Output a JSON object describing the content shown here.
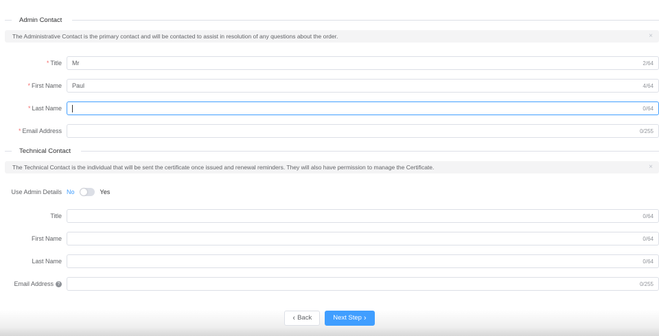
{
  "colors": {
    "accent": "#409eff",
    "required": "#f56c6c",
    "alert_bg": "#f4f4f5",
    "border": "#dcdfe6",
    "text": "#606266",
    "counter": "#909399"
  },
  "admin_section": {
    "title": "Admin Contact",
    "alert": "The Administrative Contact is the primary contact and will be contacted to assist in resolution of any questions about the order.",
    "close_label": "×",
    "fields": [
      {
        "label": "Title",
        "required": true,
        "value": "Mr",
        "counter": "2/64",
        "focused": false,
        "help": false
      },
      {
        "label": "First Name",
        "required": true,
        "value": "Paul",
        "counter": "4/64",
        "focused": false,
        "help": false
      },
      {
        "label": "Last Name",
        "required": true,
        "value": "",
        "counter": "0/64",
        "focused": true,
        "help": false
      },
      {
        "label": "Email Address",
        "required": true,
        "value": "",
        "counter": "0/255",
        "focused": false,
        "help": false
      }
    ]
  },
  "technical_section": {
    "title": "Technical Contact",
    "alert": "The Technical Contact is the individual that will be sent the certificate once issued and renewal reminders. They will also have permission to manage the Certificate.",
    "close_label": "×",
    "toggle": {
      "label": "Use Admin Details",
      "off_label": "No",
      "on_label": "Yes",
      "state": "off"
    },
    "fields": [
      {
        "label": "Title",
        "required": false,
        "value": "",
        "counter": "0/64",
        "focused": false,
        "help": false
      },
      {
        "label": "First Name",
        "required": false,
        "value": "",
        "counter": "0/64",
        "focused": false,
        "help": false
      },
      {
        "label": "Last Name",
        "required": false,
        "value": "",
        "counter": "0/64",
        "focused": false,
        "help": false
      },
      {
        "label": "Email Address",
        "required": false,
        "value": "",
        "counter": "0/255",
        "focused": false,
        "help": true
      }
    ]
  },
  "help_icon_glyph": "?",
  "footer": {
    "back_label": "Back",
    "next_label": "Next Step",
    "back_chevron": "‹",
    "next_chevron": "›"
  }
}
